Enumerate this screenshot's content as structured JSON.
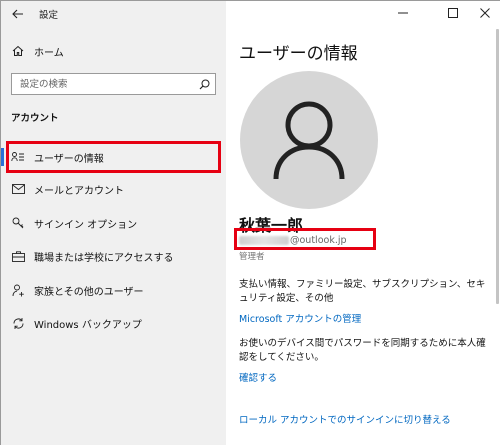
{
  "window": {
    "title": "設定",
    "controls": [
      "minimize",
      "maximize",
      "close"
    ]
  },
  "sidebar": {
    "home_label": "ホーム",
    "search": {
      "placeholder": "設定の検索",
      "value": ""
    },
    "section_heading": "アカウント",
    "items": [
      {
        "label": "ユーザーの情報",
        "icon": "user-info-icon",
        "selected": true
      },
      {
        "label": "メールとアカウント",
        "icon": "mail-icon"
      },
      {
        "label": "サインイン オプション",
        "icon": "key-icon"
      },
      {
        "label": "職場または学校にアクセスする",
        "icon": "briefcase-icon"
      },
      {
        "label": "家族とその他のユーザー",
        "icon": "add-person-icon"
      },
      {
        "label": "Windows バックアップ",
        "icon": "sync-icon"
      }
    ]
  },
  "main": {
    "page_title": "ユーザーの情報",
    "user_name": "秋葉一郎",
    "email_domain": "@outlook.jp",
    "role": "管理者",
    "billing_text": "支払い情報、ファミリー設定、サブスクリプション、セキュリティ設定、その他",
    "manage_link": "Microsoft アカウントの管理",
    "verify_text": "お使いのデバイス間でパスワードを同期するために本人確認をしてください。",
    "verify_link": "確認する",
    "local_link": "ローカル アカウントでのサインインに切り替える"
  },
  "colors": {
    "accent": "#0067c0",
    "highlight": "#e60012",
    "sidebar_bg": "#f0f0f0",
    "avatar_bg": "#d6d6d6"
  }
}
